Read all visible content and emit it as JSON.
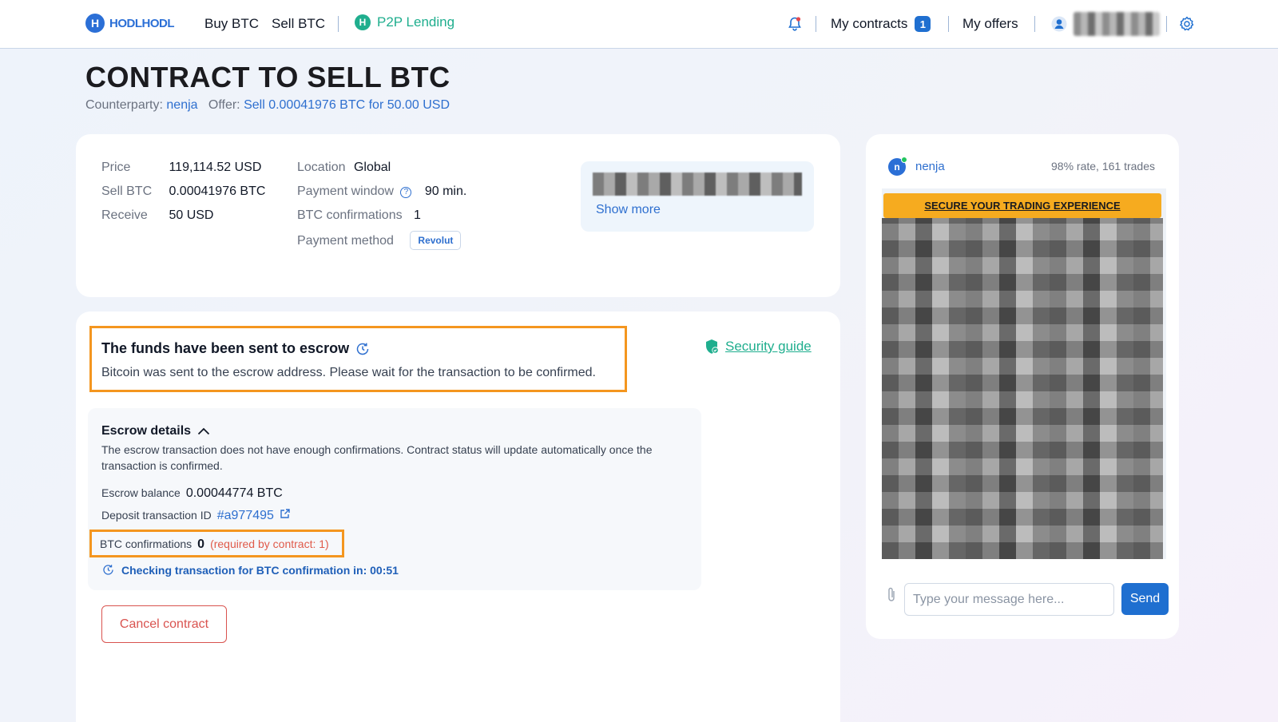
{
  "header": {
    "logo_mark": "H",
    "logo_text": "HODLHODL",
    "nav": {
      "buy": "Buy BTC",
      "sell": "Sell BTC",
      "lending": "P2P Lending",
      "lending_mark": "H"
    },
    "my_contracts": "My contracts",
    "contracts_count": "1",
    "my_offers": "My offers",
    "icons": {
      "notifications": "bell-icon",
      "user": "user-icon",
      "settings": "gear-icon"
    }
  },
  "page": {
    "title": "CONTRACT TO SELL BTC",
    "counterparty_label": "Counterparty:",
    "counterparty": "nenja",
    "offer_label": "Offer:",
    "offer": "Sell 0.00041976 BTC for 50.00 USD"
  },
  "details": {
    "price_label": "Price",
    "price": "119,114.52 USD",
    "sell_label": "Sell BTC",
    "sell": "0.00041976 BTC",
    "receive_label": "Receive",
    "receive": "50 USD",
    "location_label": "Location",
    "location": "Global",
    "window_label": "Payment window",
    "window": "90 min.",
    "conf_label": "BTC confirmations",
    "conf": "1",
    "method_label": "Payment method",
    "method": "Revolut",
    "show_more": "Show more"
  },
  "escrow": {
    "status_title": "The funds have been sent to escrow",
    "status_desc": "Bitcoin was sent to the escrow address. Please wait for the transaction to be confirmed.",
    "security_guide": "Security guide",
    "details_title": "Escrow details",
    "details_desc": "The escrow transaction does not have enough confirmations. Contract status will update automatically once the transaction is confirmed.",
    "balance_label": "Escrow balance",
    "balance": "0.00044774 BTC",
    "deposit_label": "Deposit transaction ID",
    "deposit": "#a977495",
    "conf_label": "BTC confirmations",
    "conf": "0",
    "conf_required": "(required by contract: 1)",
    "checking": "Checking transaction for BTC confirmation in: 00:51",
    "cancel": "Cancel contract"
  },
  "chat": {
    "avatar_letter": "n",
    "name": "nenja",
    "rate": "98% rate, 161 trades",
    "banner": "SECURE YOUR TRADING EXPERIENCE",
    "placeholder": "Type your message here...",
    "send": "Send"
  },
  "colors": {
    "accent": "#2e6fcf",
    "highlight": "#f4961f",
    "green": "#1fae8e",
    "danger": "#d9534f",
    "banner": "#f6ab1f"
  }
}
